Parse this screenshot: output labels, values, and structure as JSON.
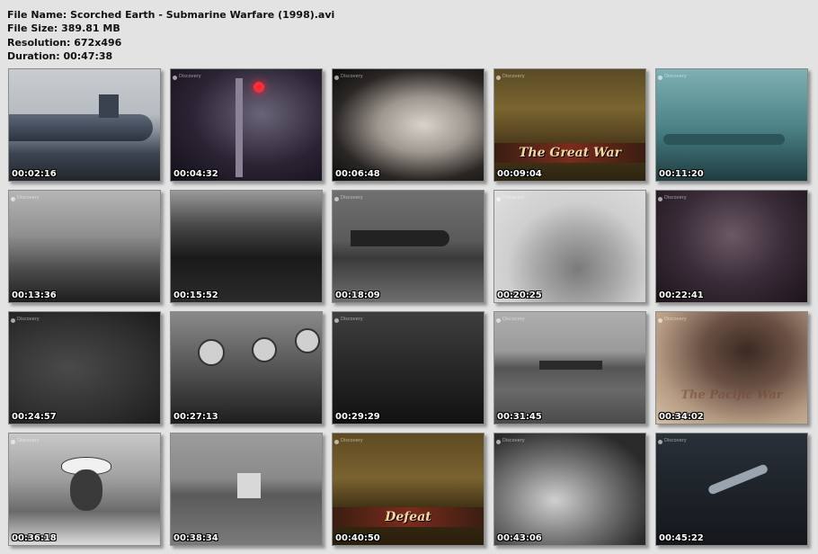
{
  "file_info": {
    "name_line": "File Name: Scorched Earth - Submarine Warfare (1998).avi",
    "size_line": "File Size: 389.81 MB",
    "resolution_line": "Resolution: 672x496",
    "duration_line": "Duration: 00:47:38"
  },
  "thumbnails": [
    {
      "time": "00:02:16"
    },
    {
      "time": "00:04:32"
    },
    {
      "time": "00:06:48"
    },
    {
      "time": "00:09:04",
      "caption": "The Great War"
    },
    {
      "time": "00:11:20"
    },
    {
      "time": "00:13:36"
    },
    {
      "time": "00:15:52"
    },
    {
      "time": "00:18:09"
    },
    {
      "time": "00:20:25"
    },
    {
      "time": "00:22:41"
    },
    {
      "time": "00:24:57"
    },
    {
      "time": "00:27:13"
    },
    {
      "time": "00:29:29"
    },
    {
      "time": "00:31:45"
    },
    {
      "time": "00:34:02",
      "caption": "The Pacific War"
    },
    {
      "time": "00:36:18"
    },
    {
      "time": "00:38:34"
    },
    {
      "time": "00:40:50",
      "caption": "Defeat"
    },
    {
      "time": "00:43:06"
    },
    {
      "time": "00:45:22"
    }
  ],
  "logo_text": "Discovery",
  "colors": {
    "background": "#e3e3e3",
    "timestamp": "#ffffff",
    "caption_gold": "#f3d9a0"
  }
}
